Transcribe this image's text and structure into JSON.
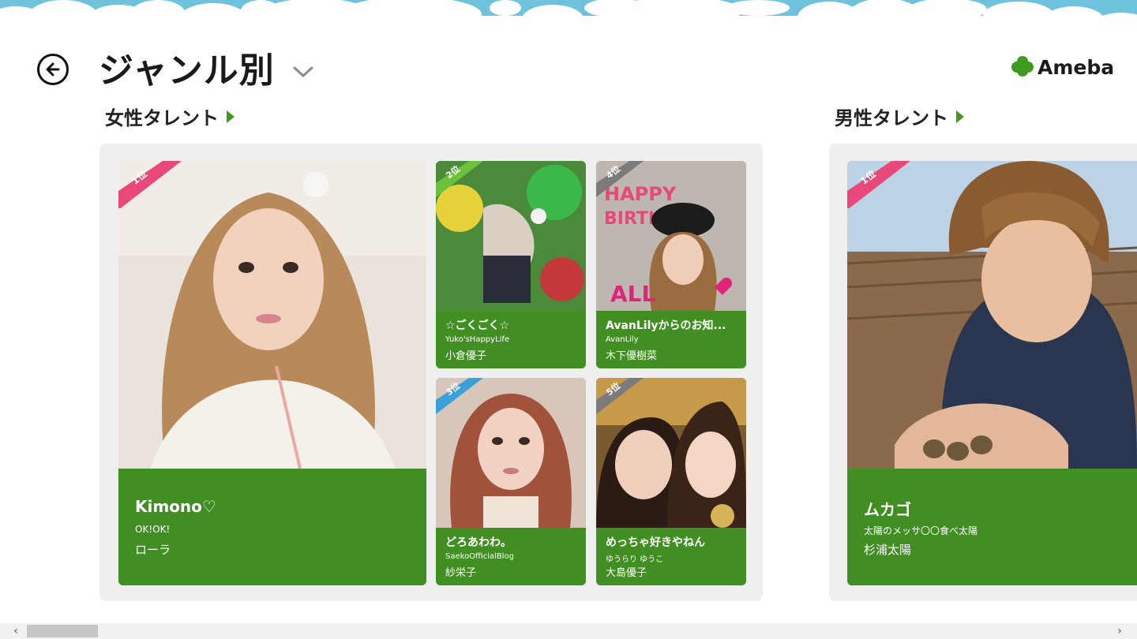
{
  "header": {
    "title": "ジャンル別",
    "logo_text": "Ameba"
  },
  "sections": [
    {
      "heading": "女性タレント",
      "cards": [
        {
          "rank": "1位",
          "title": "Kimono♡",
          "blog": "OK!OK!",
          "name": "ローラ",
          "ribbon_color": "#e8487a"
        },
        {
          "rank": "2位",
          "title": "☆ごくごく☆",
          "blog": "Yuko'sHappyLife",
          "name": "小倉優子",
          "ribbon_color": "#6cc23a"
        },
        {
          "rank": "4位",
          "title": "AvanLilyからのお知...",
          "blog": "AvanLily",
          "name": "木下優樹菜",
          "ribbon_color": "#7b7b7b"
        },
        {
          "rank": "3位",
          "title": "どろあわわ。",
          "blog": "SaekoOfficialBlog",
          "name": "紗栄子",
          "ribbon_color": "#3aa0d8"
        },
        {
          "rank": "5位",
          "title": "めっちゃ好きやねん",
          "blog": "ゆうらり ゆうこ",
          "name": "大島優子",
          "ribbon_color": "#7b7b7b"
        }
      ]
    },
    {
      "heading": "男性タレント",
      "cards": [
        {
          "rank": "1位",
          "title": "ムカゴ",
          "blog": "太陽のメッサ〇〇食べ太陽",
          "name": "杉浦太陽",
          "ribbon_color": "#e8487a"
        }
      ]
    }
  ],
  "icons": {
    "back": "back-arrow-icon",
    "chevron": "chevron-down-icon",
    "logo": "ameba-clover-icon"
  },
  "colors": {
    "accent_green": "#418f23",
    "panel_bg": "#efefef",
    "sky_blue": "#6fc2db"
  }
}
